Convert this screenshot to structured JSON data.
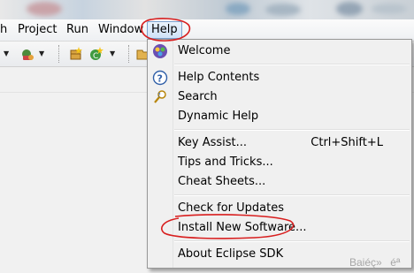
{
  "menubar": {
    "items": [
      "h",
      "Project",
      "Run",
      "Window",
      "Help"
    ]
  },
  "help_menu": {
    "items": {
      "welcome": "Welcome",
      "help_contents": "Help Contents",
      "search": "Search",
      "dynamic_help": "Dynamic Help",
      "key_assist": "Key Assist...",
      "key_assist_shortcut": "Ctrl+Shift+L",
      "tips_and_tricks": "Tips and Tricks...",
      "cheat_sheets": "Cheat Sheets...",
      "check_for_updates": "Check for Updates",
      "install_new_software": "Install New Software...",
      "about": "About Eclipse SDK"
    }
  },
  "watermark": "Baiéç»éª"
}
